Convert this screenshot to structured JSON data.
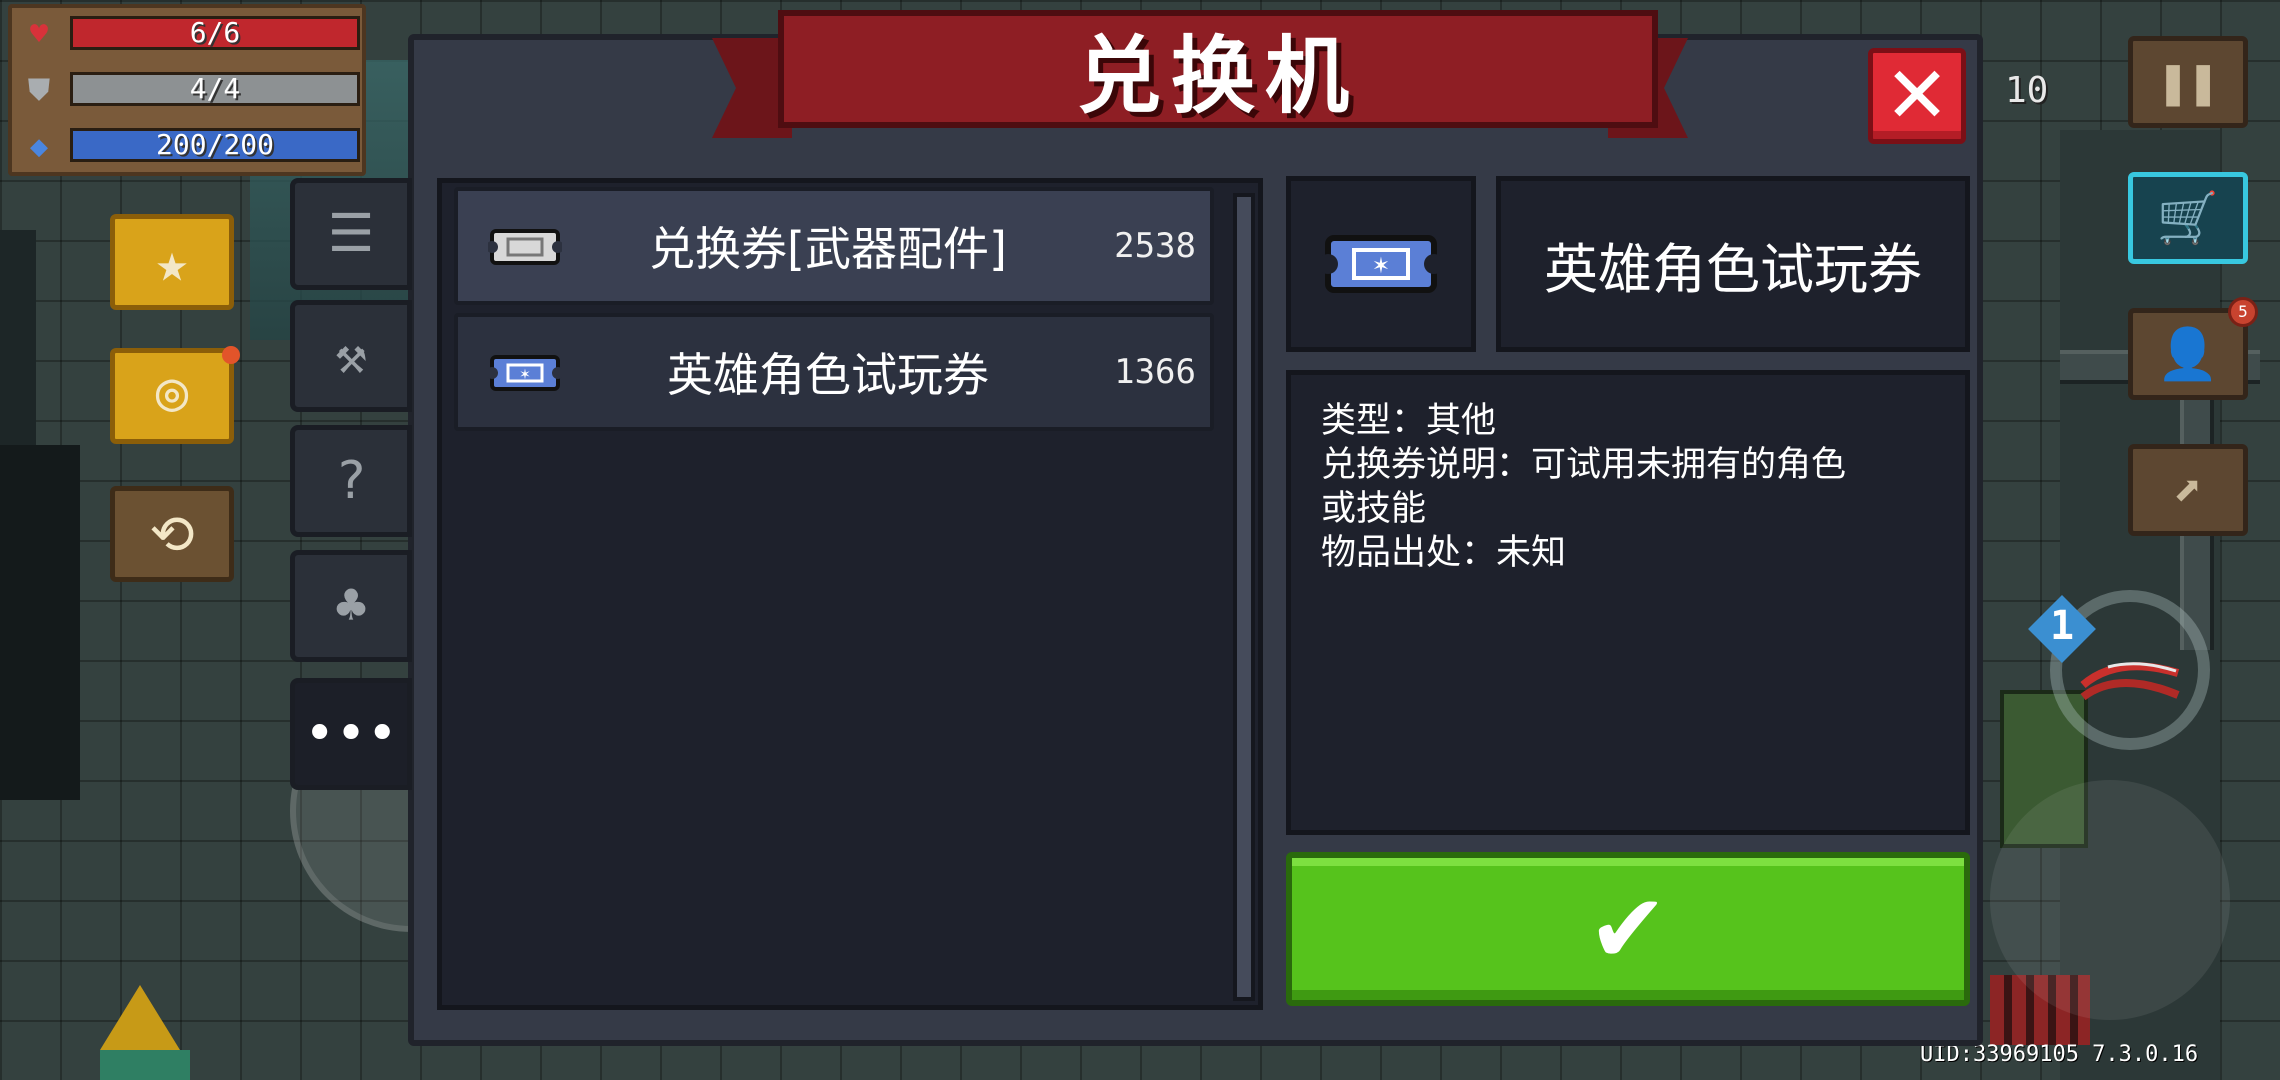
{
  "hud": {
    "hp": "6/6",
    "armor": "4/4",
    "energy": "200/200"
  },
  "top_right": {
    "count": "10",
    "notification_badge": "5",
    "skill_level": "1"
  },
  "uid_text": "UID:33969105 7.3.0.16",
  "modal": {
    "title": "兑换机",
    "close_label": "✕",
    "tabs": [
      {
        "icon": "list-icon",
        "glyph": "☰"
      },
      {
        "icon": "weapon-icon",
        "glyph": "⚒"
      },
      {
        "icon": "mystery-icon",
        "glyph": "?"
      },
      {
        "icon": "plant-icon",
        "glyph": "♣"
      },
      {
        "icon": "more-icon",
        "glyph": "•••"
      }
    ],
    "list": [
      {
        "name": "兑换券[武器配件]",
        "count": "2538",
        "ticket": "weapon-parts-ticket-icon"
      },
      {
        "name": "英雄角色试玩券",
        "count": "1366",
        "ticket": "hero-trial-ticket-icon"
      }
    ],
    "detail": {
      "title": "英雄角色试玩券",
      "lines": [
        "类型：其他",
        "兑换券说明：可试用未拥有的角色",
        "或技能",
        "物品出处：未知"
      ]
    },
    "confirm_label": "✔"
  },
  "colors": {
    "banner": "#8e1e24",
    "close": "#e02a35",
    "confirm": "#56c31c",
    "panel": "#1e212c"
  }
}
